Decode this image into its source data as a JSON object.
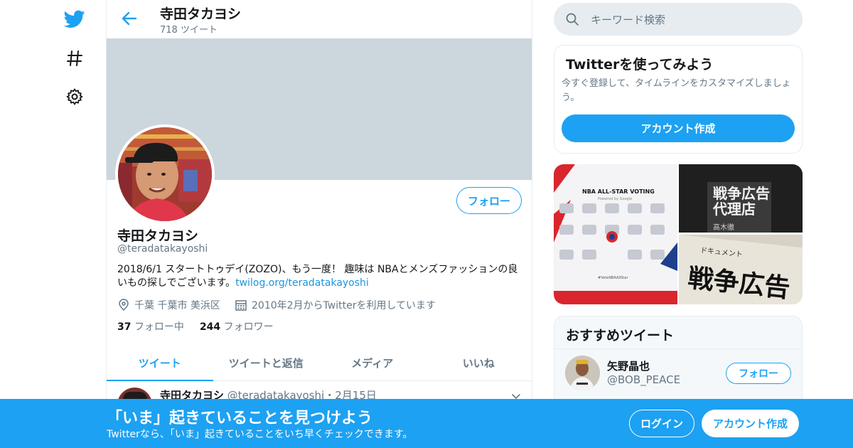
{
  "colors": {
    "accent": "#1da1f2",
    "banner": "#ccd6dd",
    "secondary_text": "#657786",
    "divider": "#e6ecf0"
  },
  "nav": {
    "icons": [
      "twitter-bird-icon",
      "hashtag-icon",
      "gear-icon"
    ]
  },
  "header": {
    "name": "寺田タカヨシ",
    "tweet_count": "718 ツイート"
  },
  "profile": {
    "name": "寺田タカヨシ",
    "handle": "@teradatakayoshi",
    "follow_label": "フォロー",
    "bio_text": "2018/6/1 スタートトゥデイ(ZOZO)、もう一度！ 趣味は NBAとメンズファッションの良いもの探しでございます。",
    "bio_link": "twilog.org/teradatakayoshi",
    "location": "千葉 千葉市 美浜区",
    "joined": "2010年2月からTwitterを利用しています",
    "following_count": "37",
    "following_label": "フォロー中",
    "followers_count": "244",
    "followers_label": "フォロワー"
  },
  "tabs": [
    {
      "label": "ツイート",
      "active": true
    },
    {
      "label": "ツイートと返信",
      "active": false
    },
    {
      "label": "メディア",
      "active": false
    },
    {
      "label": "いいね",
      "active": false
    }
  ],
  "tweet": {
    "name": "寺田タカヨシ",
    "handle": "@teradatakayoshi",
    "separator": "・",
    "date": "2月15日"
  },
  "search": {
    "placeholder": "キーワード検索"
  },
  "signup_card": {
    "title": "Twitterを使ってみよう",
    "description": "今すぐ登録して、タイムラインをカスタマイズしましょう。",
    "button": "アカウント作成"
  },
  "media": {
    "nba": {
      "title": "NBA ALL-STAR VOTING",
      "powered": "Powered by Google",
      "hashtag": "#VoteNBAAllStar"
    },
    "book1": {
      "line1": "戦争広告",
      "line2": "代理店",
      "author": "高木徹"
    },
    "book2": {
      "tag": "ドキュメント",
      "line1": "戦争広告"
    }
  },
  "recommended": {
    "title": "おすすめツイート",
    "user": {
      "name": "矢野晶也",
      "handle": "@BOB_PEACE",
      "follow_label": "フォロー"
    }
  },
  "bottom_bar": {
    "headline": "「いま」起きていることを見つけよう",
    "subtext": "Twitterなら、「いま」起きていることをいち早くチェックできます。",
    "login": "ログイン",
    "signup": "アカウント作成"
  }
}
